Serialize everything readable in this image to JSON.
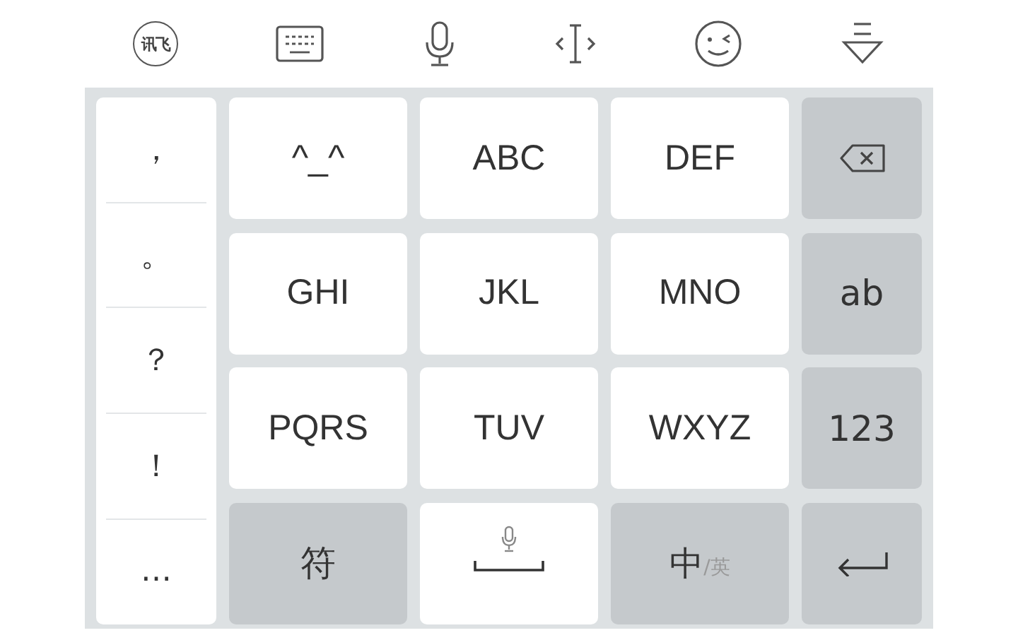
{
  "toolbar": {
    "logo_text": "讯飞"
  },
  "punctuation": [
    "，",
    "。",
    "？",
    "！",
    "…"
  ],
  "keys": [
    {
      "kind": "char",
      "label": "^_^"
    },
    {
      "kind": "char",
      "label": "ABC"
    },
    {
      "kind": "char",
      "label": "DEF"
    },
    {
      "kind": "backspace"
    },
    {
      "kind": "char",
      "label": "GHI"
    },
    {
      "kind": "char",
      "label": "JKL"
    },
    {
      "kind": "char",
      "label": "MNO"
    },
    {
      "kind": "func",
      "label": "ab"
    },
    {
      "kind": "char",
      "label": "PQRS"
    },
    {
      "kind": "char",
      "label": "TUV"
    },
    {
      "kind": "char",
      "label": "WXYZ"
    },
    {
      "kind": "func",
      "label": "123"
    },
    {
      "kind": "func",
      "label": "符"
    },
    {
      "kind": "space"
    },
    {
      "kind": "lang",
      "label": "中",
      "secondary": "/英"
    },
    {
      "kind": "enter"
    }
  ]
}
